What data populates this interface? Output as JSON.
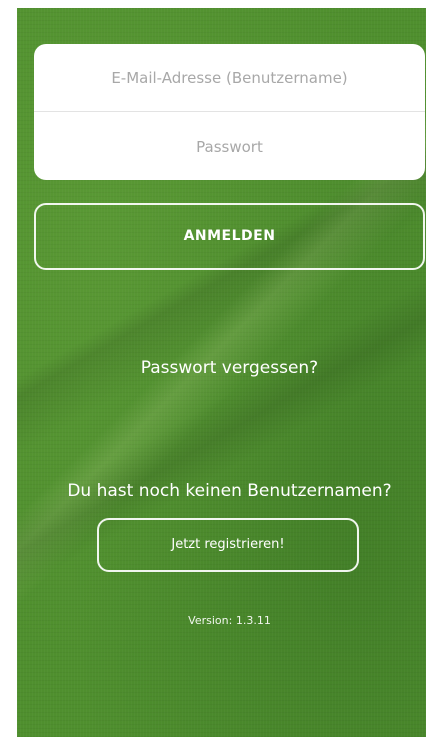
{
  "header": {
    "partial_title": "—"
  },
  "login_form": {
    "email_placeholder": "E-Mail-Adresse (Benutzername)",
    "email_value": "",
    "password_placeholder": "Passwort",
    "password_value": ""
  },
  "actions": {
    "login_label": "ANMELDEN",
    "forgot_password": "Passwort vergessen?",
    "no_account_text": "Du hast noch keinen Benutzernamen?",
    "register_label": "Jetzt registrieren!"
  },
  "footer": {
    "version": "Version: 1.3.11"
  },
  "colors": {
    "background_green": "#4f8f2e",
    "card": "#ffffff",
    "placeholder": "#a8a8a8",
    "button_border": "#ffffff"
  }
}
